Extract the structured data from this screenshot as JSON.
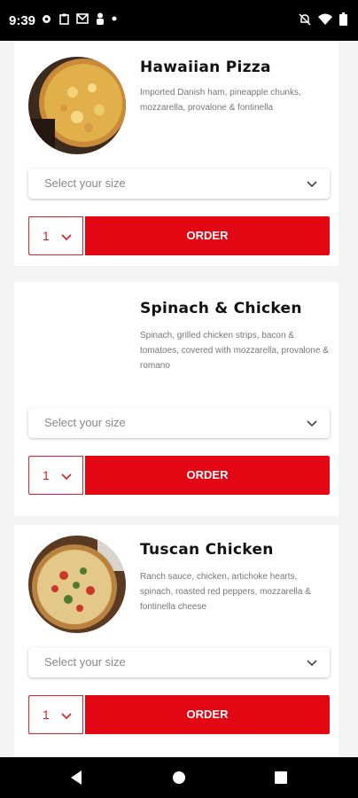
{
  "status_bar": {
    "time": "9:39",
    "left_icons": [
      "gear-icon",
      "clipboard-icon",
      "mail-icon",
      "person-icon",
      "dot-icon"
    ],
    "right_icons": [
      "no-alarm-icon",
      "wifi-icon",
      "battery-icon"
    ]
  },
  "products": [
    {
      "title": "Hawaiian Pizza",
      "description": "Imported Danish ham, pineapple chunks, mozzarella, provalone & fontinella",
      "size_placeholder": "Select your size",
      "quantity": "1",
      "order_label": "ORDER",
      "has_image": true
    },
    {
      "title": "Spinach & Chicken",
      "description": "Spinach, grilled chicken strips, bacon & tomatoes, covered with mozzarella, provalone & romano",
      "size_placeholder": "Select your size",
      "quantity": "1",
      "order_label": "ORDER",
      "has_image": false
    },
    {
      "title": "Tuscan Chicken",
      "description": "Ranch sauce, chicken, artichoke hearts, spinach, roasted red peppers, mozzarella & fontinella cheese",
      "size_placeholder": "Select your size",
      "quantity": "1",
      "order_label": "ORDER",
      "has_image": true
    }
  ],
  "colors": {
    "accent": "#e30613",
    "page_bg": "#f4f4f4"
  },
  "nav": [
    "back-icon",
    "home-icon",
    "recents-icon"
  ]
}
